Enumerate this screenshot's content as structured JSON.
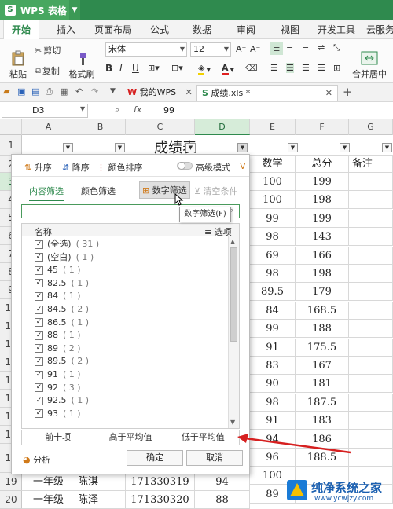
{
  "app": {
    "title": "WPS 表格"
  },
  "ribbon_tabs": [
    "开始",
    "插入",
    "页面布局",
    "公式",
    "数据",
    "审阅",
    "视图",
    "开发工具",
    "云服务"
  ],
  "ribbon": {
    "paste": "粘贴",
    "cut": "剪切",
    "copy": "复制",
    "format_painter": "格式刷",
    "font_name": "宋体",
    "font_size": "12",
    "merge_center": "合并居中"
  },
  "file_tabs": {
    "home": "我的WPS",
    "current": "成绩.xls *"
  },
  "formula_bar": {
    "cell_ref": "D3",
    "fx": "fx",
    "value": "99"
  },
  "columns": [
    "A",
    "B",
    "C",
    "D",
    "E",
    "F",
    "G"
  ],
  "rows": [
    "1",
    "2",
    "3",
    "4",
    "5",
    "6",
    "7",
    "8",
    "9",
    "10",
    "11",
    "12",
    "13",
    "14",
    "15",
    "16",
    "17",
    "18",
    "19",
    "20"
  ],
  "sheet": {
    "title": "成绩表",
    "headers": {
      "math": "数学",
      "total": "总分",
      "remark": "备注"
    },
    "math": [
      "100",
      "100",
      "99",
      "98",
      "69",
      "98",
      "89.5",
      "84",
      "99",
      "91",
      "83",
      "90",
      "98",
      "91",
      "94",
      "96",
      "100",
      "89"
    ],
    "total": [
      "199",
      "198",
      "199",
      "143",
      "166",
      "198",
      "179",
      "168.5",
      "188",
      "175.5",
      "167",
      "181",
      "187.5",
      "183",
      "186",
      "188.5",
      "",
      ""
    ],
    "row19": {
      "grade": "一年级",
      "name": "陈淇",
      "id": "171330319",
      "score": "94"
    },
    "row20": {
      "grade": "一年级",
      "name": "陈泽",
      "id": "171330320",
      "score": "88"
    }
  },
  "filter_dialog": {
    "sort_asc": "升序",
    "sort_desc": "降序",
    "sort_color": "颜色排序",
    "advanced_mode": "高级模式",
    "tab_content": "内容筛选",
    "tab_color": "颜色筛选",
    "number_filter": "数字筛选",
    "clear_conditions": "清空条件",
    "tooltip": "数字筛选(F)",
    "list_header": "名称",
    "options": "选项",
    "items": [
      {
        "label": "(全选)",
        "count": "( 31 )"
      },
      {
        "label": "(空白)",
        "count": "( 1 )"
      },
      {
        "label": "45",
        "count": "( 1 )"
      },
      {
        "label": "82.5",
        "count": "( 1 )"
      },
      {
        "label": "84",
        "count": "( 1 )"
      },
      {
        "label": "84.5",
        "count": "( 2 )"
      },
      {
        "label": "86.5",
        "count": "( 1 )"
      },
      {
        "label": "88",
        "count": "( 1 )"
      },
      {
        "label": "89",
        "count": "( 2 )"
      },
      {
        "label": "89.5",
        "count": "( 2 )"
      },
      {
        "label": "91",
        "count": "( 1 )"
      },
      {
        "label": "92",
        "count": "( 3 )"
      },
      {
        "label": "92.5",
        "count": "( 1 )"
      },
      {
        "label": "93",
        "count": "( 1 )"
      }
    ],
    "bottom_tabs": [
      "前十项",
      "高于平均值",
      "低于平均值"
    ],
    "analysis": "分析",
    "ok": "确定",
    "cancel": "取消"
  },
  "watermark": {
    "title": "纯净系统之家",
    "url": "www.ycwjzy.com"
  },
  "colors": {
    "brand": "#2f8a4e",
    "arrow": "#d62020"
  }
}
